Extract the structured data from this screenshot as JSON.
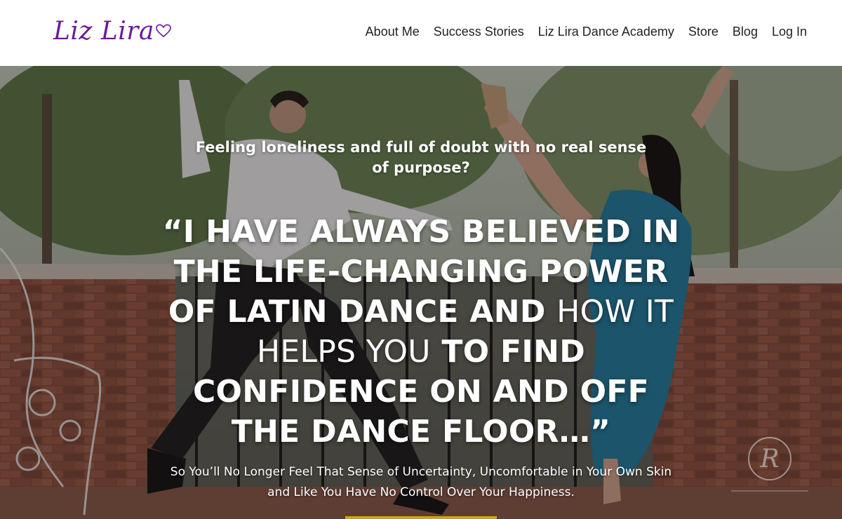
{
  "header": {
    "logo_text": "Liz Lira",
    "nav": [
      {
        "label": "About Me"
      },
      {
        "label": "Success Stories"
      },
      {
        "label": "Liz Lira Dance Academy"
      },
      {
        "label": "Store"
      },
      {
        "label": "Blog"
      },
      {
        "label": "Log In"
      }
    ]
  },
  "hero": {
    "kicker": "Feeling loneliness and full of doubt with no real sense of purpose?",
    "quote_part1": "“I HAVE ALWAYS BELIEVED IN THE LIFE-CHANGING POWER OF LATIN DANCE AND",
    "quote_light": "HOW IT HELPS YOU",
    "quote_part2": "TO FIND CONFIDENCE ON AND OFF THE DANCE FLOOR…”",
    "subtitle": "So You’ll No Longer Feel That Sense of Uncertainty, Uncomfortable in Your Own Skin and Like You Have No Control Over Your Happiness.",
    "watermark_letter": "R",
    "image_description": "dancer-couple-photo"
  },
  "colors": {
    "logo": "#6a1b9a",
    "nav_text": "#222222",
    "hero_text": "#ffffff",
    "accent": "#d4a017"
  }
}
